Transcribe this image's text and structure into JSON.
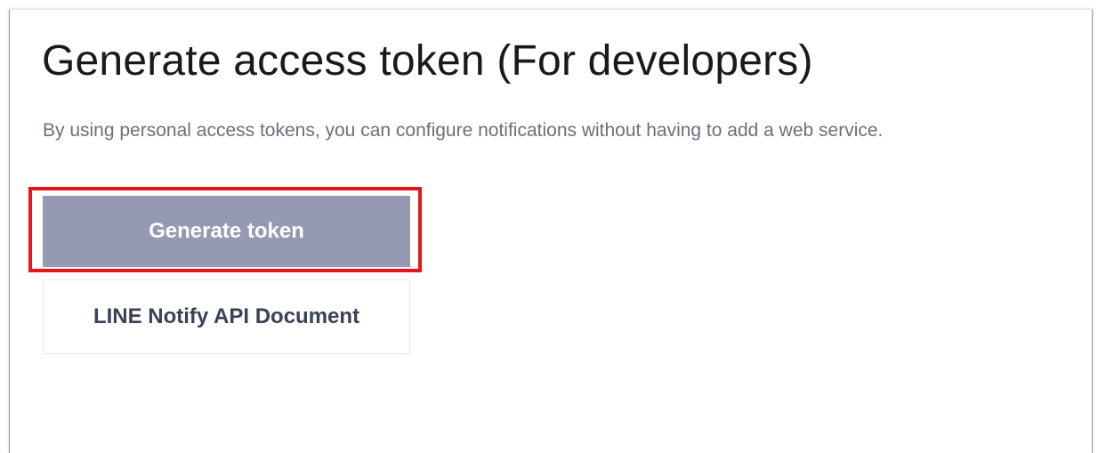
{
  "page": {
    "title": "Generate access token (For developers)",
    "description": "By using personal access tokens, you can configure notifications without having to add a web service."
  },
  "actions": {
    "generate_token_label": "Generate token",
    "api_document_label": "LINE Notify API Document"
  },
  "colors": {
    "primary_button": "#9599b2",
    "highlight_border": "#e8141c",
    "title_text": "#1a1a1a",
    "description_text": "#6b6f7a",
    "secondary_button_text": "#3b4256"
  }
}
